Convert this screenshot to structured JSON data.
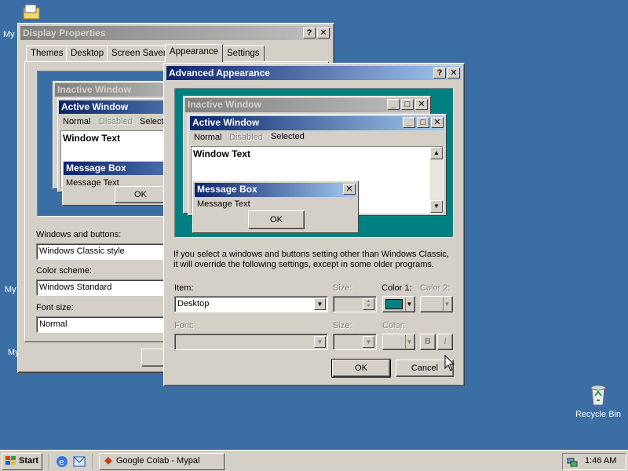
{
  "desktop": {
    "icon_labels": [
      "My",
      "My",
      "My"
    ],
    "recycle_bin": "Recycle Bin"
  },
  "display_properties": {
    "title": "Display Properties",
    "help_btn": "?",
    "close_btn": "✕",
    "tabs": [
      "Themes",
      "Desktop",
      "Screen Saver",
      "Appearance",
      "Settings"
    ],
    "selected_tab": "Appearance",
    "preview": {
      "inactive_title": "Inactive Window",
      "active_title": "Active Window",
      "menu_normal": "Normal",
      "menu_disabled": "Disabled",
      "menu_selected": "Selecte",
      "window_text": "Window Text",
      "msgbox_title": "Message Box",
      "msgbox_text": "Message Text",
      "ok": "OK"
    },
    "windows_buttons_label": "Windows and buttons:",
    "windows_buttons_value": "Windows Classic style",
    "color_scheme_label": "Color scheme:",
    "color_scheme_value": "Windows Standard",
    "font_size_label": "Font size:",
    "font_size_value": "Normal"
  },
  "advanced": {
    "title": "Advanced Appearance",
    "help_btn": "?",
    "close_btn": "✕",
    "preview": {
      "inactive_title": "Inactive Window",
      "active_title": "Active Window",
      "menu_normal": "Normal",
      "menu_disabled": "Disabled",
      "menu_selected": "Selected",
      "window_text": "Window Text",
      "msgbox_title": "Message Box",
      "msgbox_text": "Message Text",
      "ok": "OK",
      "bg_color": "#008080"
    },
    "info_line1": "If you select a windows and buttons setting other than Windows Classic,",
    "info_line2": "it will override the following settings, except in some older programs.",
    "item_label": "Item:",
    "item_value": "Desktop",
    "size_label": "Size:",
    "color1_label": "Color 1:",
    "color1_value": "#008080",
    "color2_label": "Color 2:",
    "font_label": "Font:",
    "font_size_label": "Size:",
    "font_color_label": "Color:",
    "bold_btn": "B",
    "italic_btn": "I",
    "ok": "OK",
    "cancel": "Cancel"
  },
  "taskbar": {
    "start": "Start",
    "task_label": "Google Colab - Mypal",
    "clock": "1:46 AM"
  }
}
